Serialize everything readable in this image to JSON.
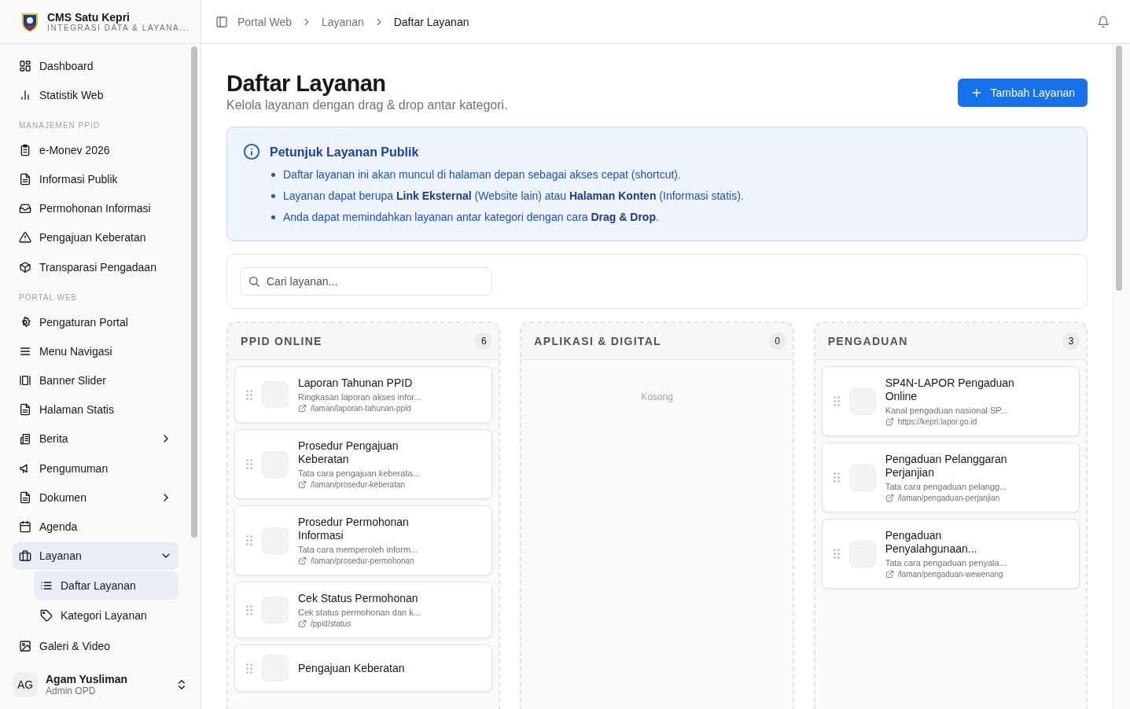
{
  "brand": {
    "name": "CMS Satu Kepri",
    "tagline": "INTEGRASI DATA & LAYANA..."
  },
  "sidebar": {
    "items": [
      {
        "kind": "link",
        "label": "Dashboard",
        "selected": false
      },
      {
        "kind": "link",
        "label": "Statistik Web",
        "selected": false
      },
      {
        "kind": "section",
        "label": "MANAJEMEN PPID"
      },
      {
        "kind": "link",
        "label": "e-Monev 2026",
        "selected": false
      },
      {
        "kind": "link",
        "label": "Informasi Publik",
        "selected": false
      },
      {
        "kind": "link",
        "label": "Permohonan Informasi",
        "selected": false
      },
      {
        "kind": "link",
        "label": "Pengajuan Keberatan",
        "selected": false
      },
      {
        "kind": "link",
        "label": "Transparasi Pengadaan",
        "selected": false
      },
      {
        "kind": "section",
        "label": "PORTAL WEB"
      },
      {
        "kind": "link",
        "label": "Pengaturan Portal",
        "selected": false
      },
      {
        "kind": "link",
        "label": "Menu Navigasi",
        "selected": false
      },
      {
        "kind": "link",
        "label": "Banner Slider",
        "selected": false
      },
      {
        "kind": "link",
        "label": "Halaman Statis",
        "selected": false
      },
      {
        "kind": "group",
        "label": "Berita",
        "selected": false,
        "expanded": false
      },
      {
        "kind": "link",
        "label": "Pengumuman",
        "selected": false
      },
      {
        "kind": "group",
        "label": "Dokumen",
        "selected": false,
        "expanded": false
      },
      {
        "kind": "link",
        "label": "Agenda",
        "selected": false
      },
      {
        "kind": "group",
        "label": "Layanan",
        "selected": true,
        "expanded": true,
        "children": [
          {
            "label": "Daftar Layanan",
            "selected": true
          },
          {
            "label": "Kategori Layanan",
            "selected": false
          }
        ]
      },
      {
        "kind": "link",
        "label": "Galeri & Video",
        "selected": false
      }
    ]
  },
  "user": {
    "initials": "AG",
    "name": "Agam Yusliman",
    "role": "Admin OPD"
  },
  "breadcrumb": [
    "Portal Web",
    "Layanan",
    "Daftar Layanan"
  ],
  "page": {
    "title": "Daftar Layanan",
    "subtitle": "Kelola layanan dengan drag & drop antar kategori.",
    "button": "Tambah Layanan"
  },
  "info": {
    "title": "Petunjuk Layanan Publik",
    "bullets": [
      "Daftar layanan ini akan muncul di halaman depan sebagai akses cepat (shortcut).",
      "Layanan dapat berupa **Link Eksternal** (Website lain) atau **Halaman Konten** (Informasi statis).",
      "Anda dapat memindahkan layanan antar kategori dengan cara **Drag & Drop**."
    ]
  },
  "search": {
    "placeholder": "Cari layanan..."
  },
  "columns": [
    {
      "title": "PPID ONLINE",
      "count": "6",
      "items": [
        {
          "title": "Laporan Tahunan PPID",
          "description": "Ringkasan laporan akses infor...",
          "url": "/laman/laporan-tahunan-ppid"
        },
        {
          "title": "Prosedur Pengajuan Keberatan",
          "description": "Tata cara pengajuan keberata...",
          "url": "/laman/prosedur-keberatan"
        },
        {
          "title": "Prosedur Permohonan Informasi",
          "description": "Tata cara memperoleh inform...",
          "url": "/laman/prosedur-permohonan"
        },
        {
          "title": "Cek Status Permohonan",
          "description": "Cek status permohonan dan k...",
          "url": "/ppid/status"
        },
        {
          "title": "Pengajuan Keberatan"
        }
      ]
    },
    {
      "title": "APLIKASI & DIGITAL",
      "count": "0",
      "empty_text": "Kosong"
    },
    {
      "title": "PENGADUAN",
      "count": "3",
      "items": [
        {
          "title": "SP4N-LAPOR Pengaduan Online",
          "description": "Kanal pengaduan nasional SP...",
          "url": "https://kepri.lapor.go.id"
        },
        {
          "title": "Pengaduan Pelanggaran Perjanjian",
          "description": "Tata cara pengaduan pelangg...",
          "url": "/laman/pengaduan-perjanjian"
        },
        {
          "title": "Pengaduan Penyalahgunaan...",
          "description": "Tata cara pengaduan penyala...",
          "url": "/laman/pengaduan-wewenang"
        }
      ]
    }
  ]
}
